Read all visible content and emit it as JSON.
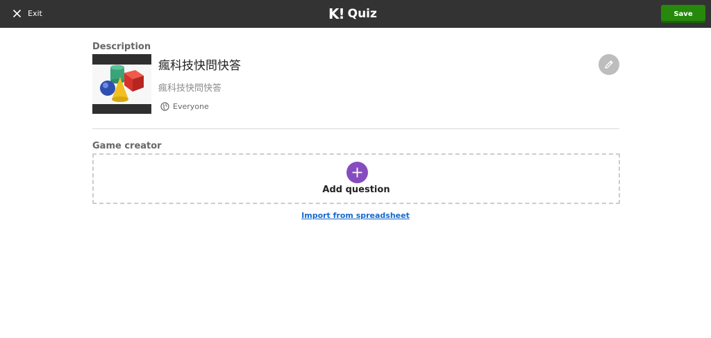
{
  "header": {
    "exit_label": "Exit",
    "brand_logo": "K!",
    "brand_name": "Quiz",
    "save_label": "Save"
  },
  "description": {
    "section_label": "Description",
    "title": "瘋科技快問快答",
    "subtitle": "瘋科技快問快答",
    "visibility": "Everyone"
  },
  "creator": {
    "section_label": "Game creator",
    "add_question_label": "Add question",
    "import_link": "Import from spreadsheet"
  },
  "icons": {
    "exit": "close-icon",
    "visibility": "globe-icon",
    "edit": "pencil-icon",
    "add": "plus-icon"
  },
  "colors": {
    "topbar": "#333333",
    "save": "#26890c",
    "add_button": "#864cbf",
    "link": "#1368ce"
  }
}
